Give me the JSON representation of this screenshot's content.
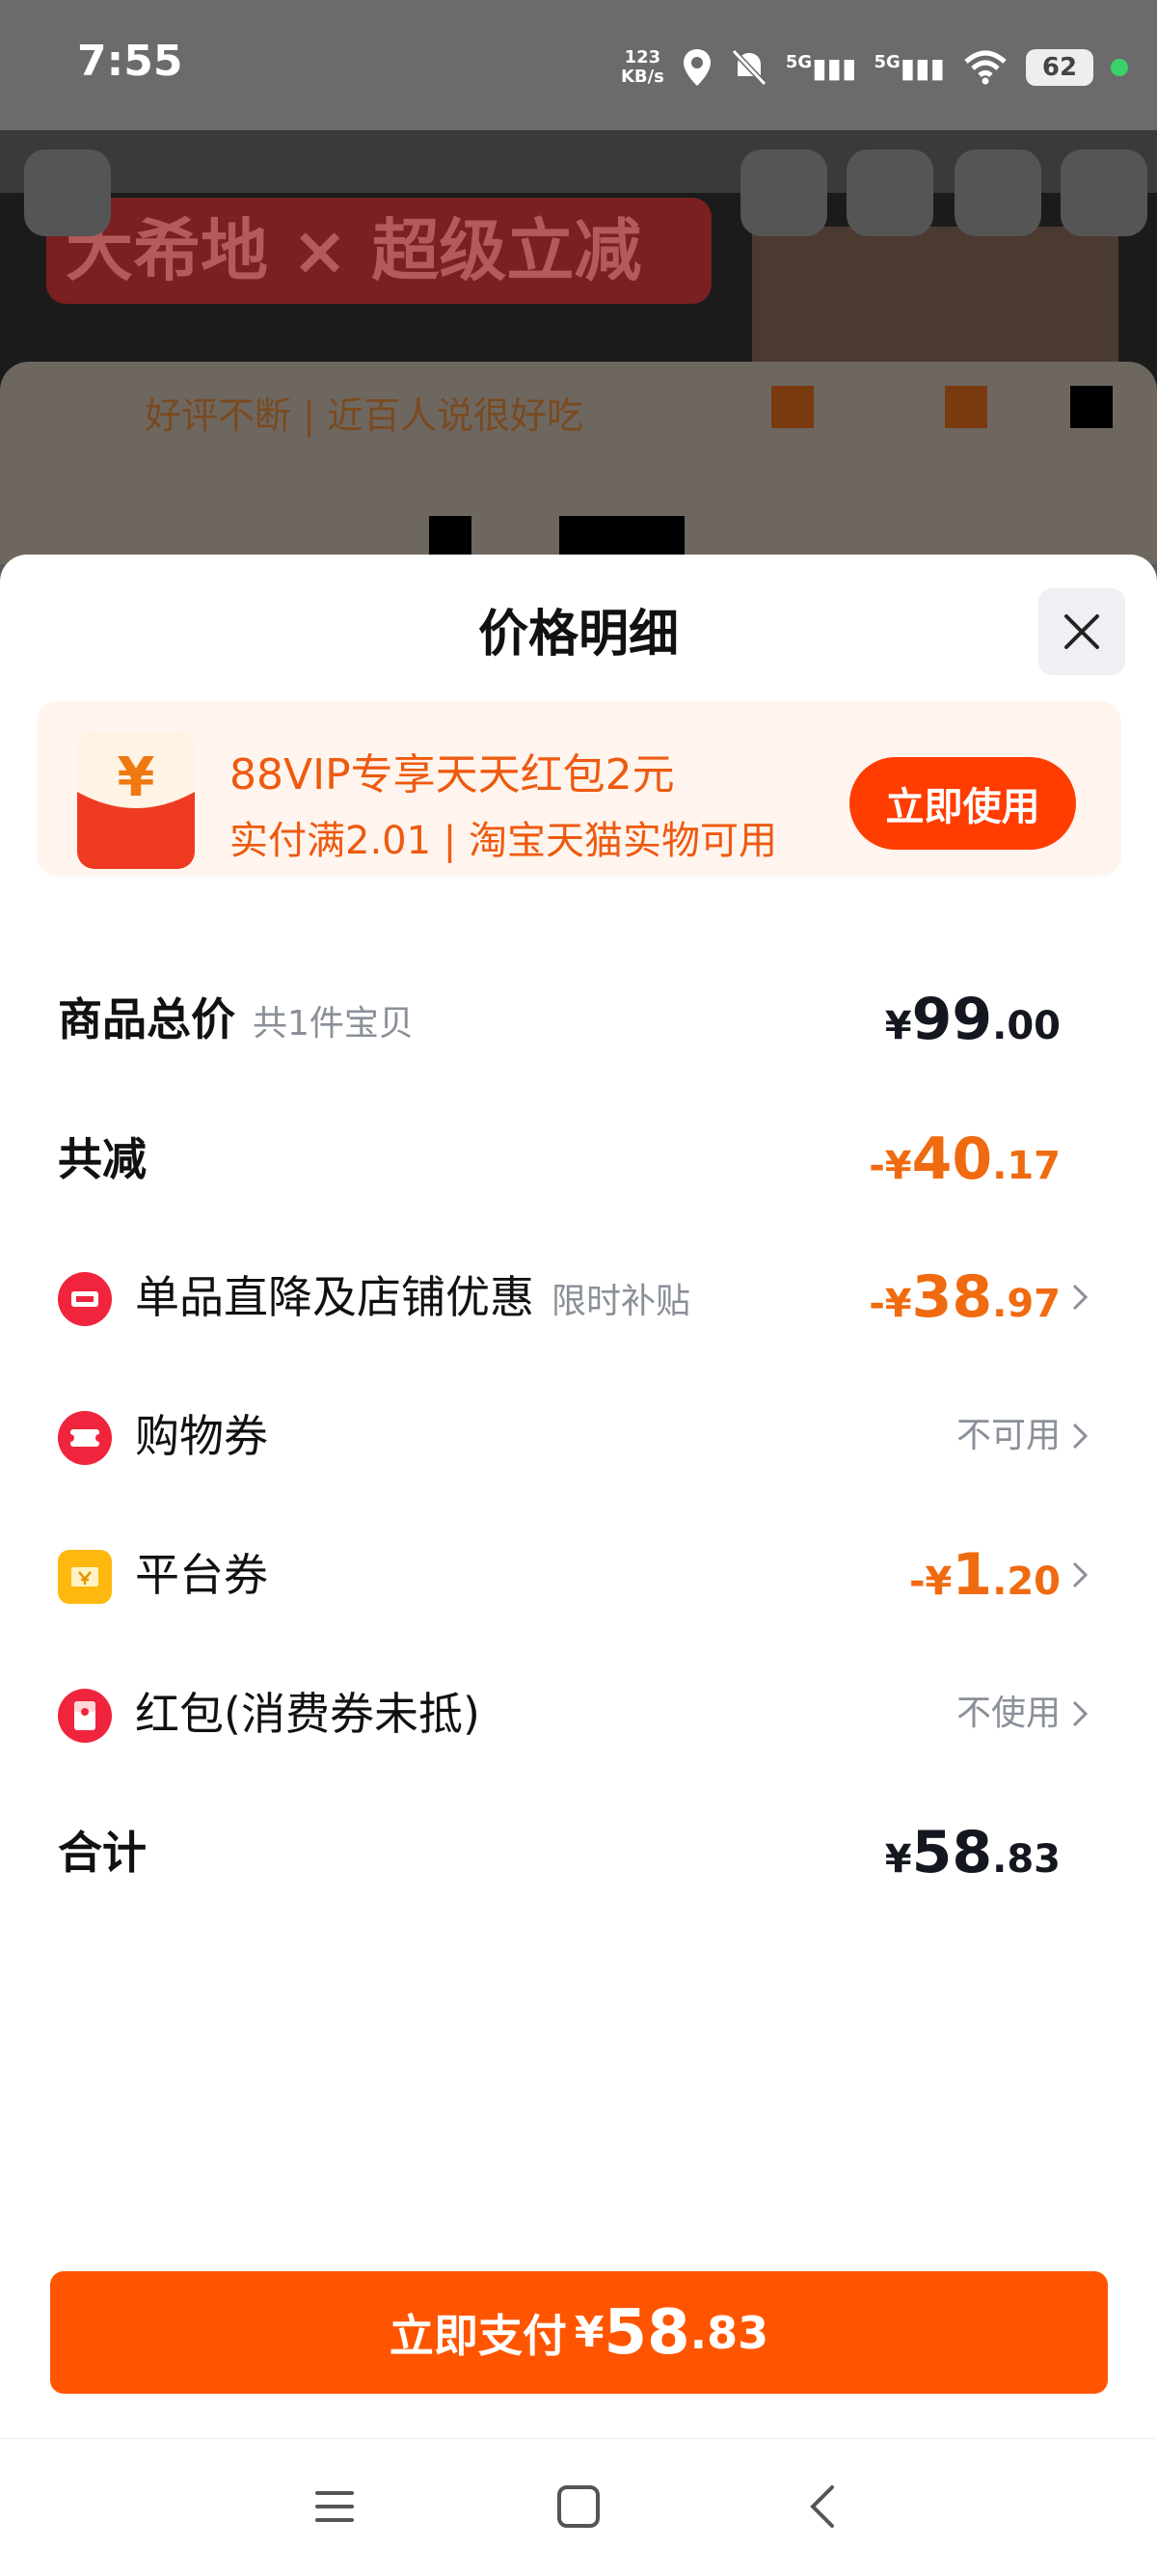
{
  "status_bar": {
    "time": "7:55",
    "net_speed_value": "123",
    "net_speed_unit": "KB/s",
    "signal1": "5G",
    "signal2": "5G",
    "battery": "62"
  },
  "background": {
    "banner_text": "大希地 × 超级立减",
    "reviews_text": "好评不断 | 近百人说很好吃"
  },
  "sheet": {
    "title": "价格明细",
    "close_label": "×"
  },
  "promo": {
    "title": "88VIP专享天天红包2元",
    "subtitle": "实付满2.01 | 淘宝天猫实物可用",
    "button": "立即使用",
    "envelope_glyph": "¥"
  },
  "rows": {
    "total": {
      "label": "商品总价",
      "sub": "共1件宝贝",
      "yen": "¥",
      "int": "99",
      "dec": ".00"
    },
    "discount": {
      "label": "共减",
      "yen": "-¥",
      "int": "40",
      "dec": ".17"
    },
    "store": {
      "label": "单品直降及店铺优惠",
      "sub": "限时补贴",
      "yen": "-¥",
      "int": "38",
      "dec": ".97"
    },
    "shopping_coupon": {
      "label": "购物券",
      "value": "不可用"
    },
    "platform_coupon": {
      "label": "平台券",
      "yen": "-¥",
      "int": "1",
      "dec": ".20"
    },
    "red_packet": {
      "label": "红包(消费券未抵)",
      "value": "不使用"
    },
    "sum": {
      "label": "合计",
      "yen": "¥",
      "int": "58",
      "dec": ".83"
    }
  },
  "pay": {
    "label": "立即支付",
    "yen": "¥",
    "int": "58",
    "dec": ".83"
  },
  "colors": {
    "accent": "#ff5500",
    "discount": "#f06a10",
    "promo_bg": "#fff5ee"
  }
}
